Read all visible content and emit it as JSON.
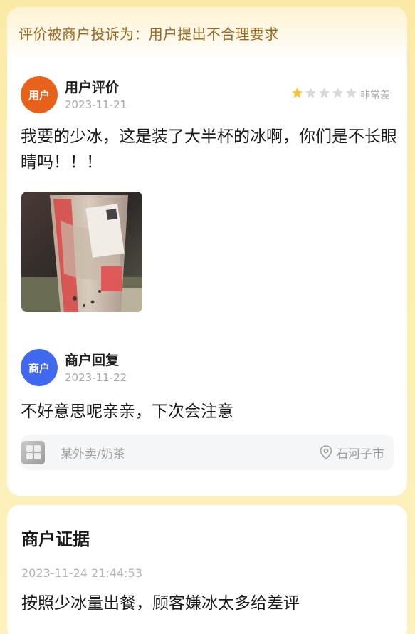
{
  "complaint_banner": "评价被商户投诉为：用户提出不合理要求",
  "review": {
    "avatar_label": "用户",
    "author": "用户评价",
    "date": "2023-11-21",
    "rating": 1,
    "rating_max": 5,
    "rating_label": "非常差",
    "text": "我要的少冰，这是装了大半杯的冰啊，你们是不长眼睛吗！！！",
    "photo_icon": "drink-cup-photo"
  },
  "reply": {
    "avatar_label": "商户",
    "author": "商户回复",
    "date": "2023-11-22",
    "text": "不好意思呢亲亲，下次会注意"
  },
  "shop": {
    "icon": "shop-thumbnail-icon",
    "name": "某外卖/奶茶",
    "location_icon": "map-pin-icon",
    "location": "石河子市"
  },
  "evidence": {
    "title": "商户证据",
    "timestamp": "2023-11-24 21:44:53",
    "text": "按照少冰量出餐，顾客嫌冰太多给差评"
  },
  "colors": {
    "user_avatar": "#e8621b",
    "merchant_avatar": "#4169f0",
    "star_active": "#f7c233",
    "star_inactive": "#d9d9d9",
    "banner_text": "#9a6a1f"
  }
}
